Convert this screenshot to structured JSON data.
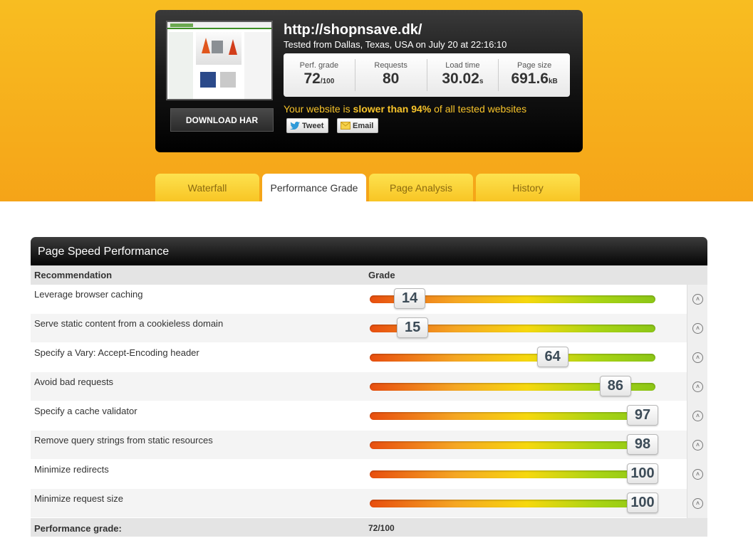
{
  "header": {
    "url": "http://shopnsave.dk/",
    "tested_from": "Tested from Dallas, Texas, USA on July 20 at 22:16:10",
    "download_label": "DOWNLOAD HAR",
    "stats": {
      "perf_grade_label": "Perf. grade",
      "perf_grade_value": "72",
      "perf_grade_unit": "/100",
      "requests_label": "Requests",
      "requests_value": "80",
      "load_time_label": "Load time",
      "load_time_value": "30.02",
      "load_time_unit": "s",
      "page_size_label": "Page size",
      "page_size_value": "691.6",
      "page_size_unit": "kB"
    },
    "verdict_pre": "Your website is ",
    "verdict_bold": "slower than 94%",
    "verdict_post": " of all tested websites",
    "tweet_label": "Tweet",
    "email_label": "Email"
  },
  "tabs": [
    {
      "label": "Waterfall",
      "active": false
    },
    {
      "label": "Performance Grade",
      "active": true
    },
    {
      "label": "Page Analysis",
      "active": false
    },
    {
      "label": "History",
      "active": false
    }
  ],
  "panel": {
    "title": "Page Speed Performance",
    "col_recommendation": "Recommendation",
    "col_grade": "Grade",
    "rows": [
      {
        "name": "Leverage browser caching",
        "grade": 14
      },
      {
        "name": "Serve static content from a cookieless domain",
        "grade": 15
      },
      {
        "name": "Specify a Vary: Accept-Encoding header",
        "grade": 64
      },
      {
        "name": "Avoid bad requests",
        "grade": 86
      },
      {
        "name": "Specify a cache validator",
        "grade": 97
      },
      {
        "name": "Remove query strings from static resources",
        "grade": 98
      },
      {
        "name": "Minimize redirects",
        "grade": 100
      },
      {
        "name": "Minimize request size",
        "grade": 100
      }
    ],
    "footer_label": "Performance grade:",
    "footer_value": "72/100"
  },
  "colors": {
    "accent": "#f8bd21",
    "verdict": "#f8c42a"
  },
  "icons": {
    "expand": "chevron-up-circle-icon",
    "tweet": "twitter-bird-icon",
    "email": "envelope-icon"
  }
}
